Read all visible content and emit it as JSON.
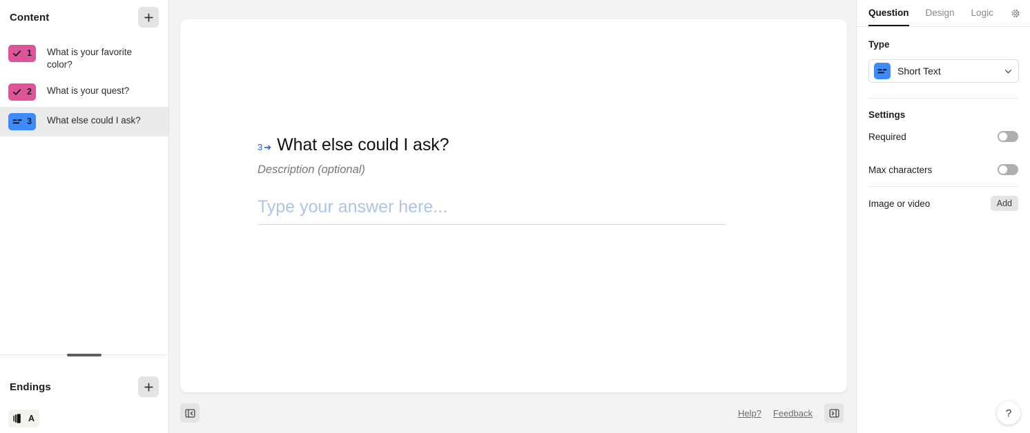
{
  "sidebar": {
    "content": {
      "title": "Content",
      "add_label": "+",
      "items": [
        {
          "number": "1",
          "label": "What is your favorite color?",
          "icon": "check-icon",
          "badge_color": "#dd5499",
          "selected": false
        },
        {
          "number": "2",
          "label": "What is your quest?",
          "icon": "check-icon",
          "badge_color": "#dd5499",
          "selected": false
        },
        {
          "number": "3",
          "label": "What else could I ask?",
          "icon": "short-text-icon",
          "badge_color": "#3d8bfd",
          "selected": true
        }
      ]
    },
    "endings": {
      "title": "Endings",
      "add_label": "+",
      "items": [
        {
          "letter": "A",
          "icon": "ending-screen-icon",
          "badge_color": "#f4f2ec"
        }
      ]
    }
  },
  "canvas": {
    "question_index": "3",
    "index_arrow": "➔",
    "question_title": "What else could I ask?",
    "description_placeholder": "Description (optional)",
    "answer_placeholder": "Type your answer here...",
    "accent_index_color": "#1f5fd0",
    "answer_placeholder_color": "#aec4e8"
  },
  "footer": {
    "collapse_left_icon": "panel-collapse-left-icon",
    "expand_right_icon": "panel-expand-right-icon",
    "links": [
      {
        "label": "Help?"
      },
      {
        "label": "Feedback"
      }
    ]
  },
  "right_panel": {
    "tabs": [
      {
        "label": "Question",
        "active": true
      },
      {
        "label": "Design",
        "active": false
      },
      {
        "label": "Logic",
        "active": false
      }
    ],
    "gear_icon": "gear-icon",
    "type": {
      "label": "Type",
      "selected_value": "Short Text",
      "icon": "short-text-icon",
      "icon_color": "#3d8bfd"
    },
    "settings": {
      "label": "Settings",
      "rows": [
        {
          "name": "Required",
          "control": "toggle",
          "value": "off"
        },
        {
          "name": "Max characters",
          "control": "toggle",
          "value": "off"
        }
      ]
    },
    "media": {
      "name": "Image or video",
      "button_label": "Add"
    }
  },
  "help_fab": {
    "label": "?"
  }
}
